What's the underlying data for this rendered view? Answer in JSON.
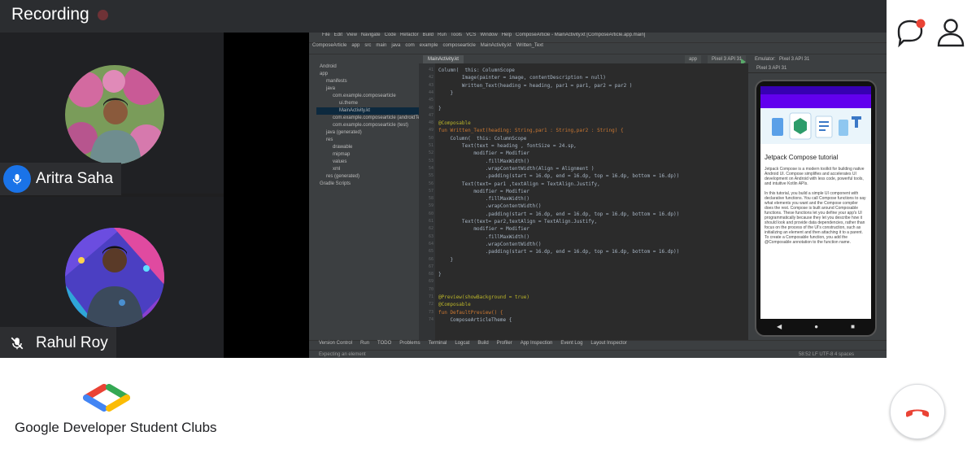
{
  "header": {
    "title": "Recording"
  },
  "participants": [
    {
      "name": "Aritra Saha",
      "mic": "active"
    },
    {
      "name": "Rahul Roy",
      "mic": "muted"
    }
  ],
  "ide": {
    "menu": [
      "File",
      "Edit",
      "View",
      "Navigate",
      "Code",
      "Refactor",
      "Build",
      "Run",
      "Tools",
      "VCS",
      "Window",
      "Help",
      "ComposeArticle - MainActivity.kt [ComposeArticle.app.main]"
    ],
    "nav": [
      "ComposeArticle",
      "app",
      "src",
      "main",
      "java",
      "com",
      "example",
      "composearticle",
      "MainActivity.kt",
      "Written_Text"
    ],
    "run_config": "app",
    "device": "Pixel 3 API 31",
    "editor_tab": "MainActivity.kt",
    "emulator_label": "Emulator:",
    "emulator_device": "Pixel 3 API 31",
    "project_tree": [
      "Android",
      "app",
      "manifests",
      "java",
      "com.example.composearticle",
      "ui.theme",
      "MainActivity.kt",
      "com.example.composearticle (androidTest)",
      "com.example.composearticle (test)",
      "java (generated)",
      "res",
      "drawable",
      "mipmap",
      "values",
      "xml",
      "res (generated)",
      "Gradle Scripts"
    ],
    "line_numbers": [
      "41",
      "42",
      "43",
      "44",
      "45",
      "46",
      "47",
      "48",
      "49",
      "50",
      "51",
      "52",
      "53",
      "54",
      "55",
      "56",
      "57",
      "58",
      "59",
      "60",
      "61",
      "62",
      "63",
      "64",
      "65",
      "66",
      "67",
      "68",
      "69",
      "70",
      "71",
      "72",
      "73",
      "74",
      "75"
    ],
    "code_lines": [
      "Column(  this: ColumnScope",
      "        Image(painter = image, contentDescription = null)",
      "        Written_Text(heading = heading, par1 = par1, par2 = par2 )",
      "    }",
      "",
      "}",
      "",
      "@Composable",
      "fun Written_Text(heading: String,par1 : String,par2 : String) {",
      "    Column(  this: ColumnScope",
      "        Text(text = heading , fontSize = 24.sp,",
      "            modifier = Modifier",
      "                .fillMaxWidth()",
      "                .wrapContentWidth(Align = Alignment )",
      "                .padding(start = 16.dp, end = 16.dp, top = 16.dp, bottom = 16.dp))",
      "        Text(text= par1 ,textAlign = TextAlign.Justify,",
      "            modifier = Modifier",
      "                .fillMaxWidth()",
      "                .wrapContentWidth()",
      "                .padding(start = 16.dp, end = 16.dp, top = 16.dp, bottom = 16.dp))",
      "        Text(text= par2,textAlign = TextAlign.Justify,",
      "            modifier = Modifier",
      "                .fillMaxWidth()",
      "                .wrapContentWidth()",
      "                .padding(start = 16.dp, end = 16.dp, top = 16.dp, bottom = 16.dp))",
      "    }",
      "",
      "}",
      "",
      "",
      "@Preview(showBackground = true)",
      "@Composable",
      "fun DefaultPreview() {",
      "    ComposeArticleTheme {"
    ],
    "bottom_tabs": [
      "Version Control",
      "Run",
      "TODO",
      "Problems",
      "Terminal",
      "Logcat",
      "Build",
      "Profiler",
      "App Inspection",
      "Event Log",
      "Layout Inspector"
    ],
    "status_text": "Expecting an element",
    "status_pos": "58:52  LF  UTF-8  4 spaces",
    "phone": {
      "title": "Jetpack Compose tutorial",
      "paragraph1": "Jetpack Compose is a modern toolkit for building native Android UI. Compose simplifies and accelerates UI development on Android with less code, powerful tools, and intuitive Kotlin APIs.",
      "paragraph2": "In this tutorial, you build a simple UI component with declarative functions. You call Compose functions to say what elements you want and the Compose compiler does the rest. Compose is built around Composable functions. These functions let you define your app's UI programmatically because they let you describe how it should look and provide data dependencies, rather than focus on the process of the UI's construction, such as initializing an element and then attaching it to a parent. To create a Composable function, you add the @Composable annotation to the function name."
    }
  },
  "footer": {
    "brand": "Google Developer Student Clubs"
  },
  "colors": {
    "gdsc_blue": "#4285f4",
    "gdsc_red": "#ea4335",
    "gdsc_green": "#34a853",
    "gdsc_yellow": "#fbbc04",
    "leave_red": "#ea4335",
    "notify_red": "#ea4335"
  }
}
